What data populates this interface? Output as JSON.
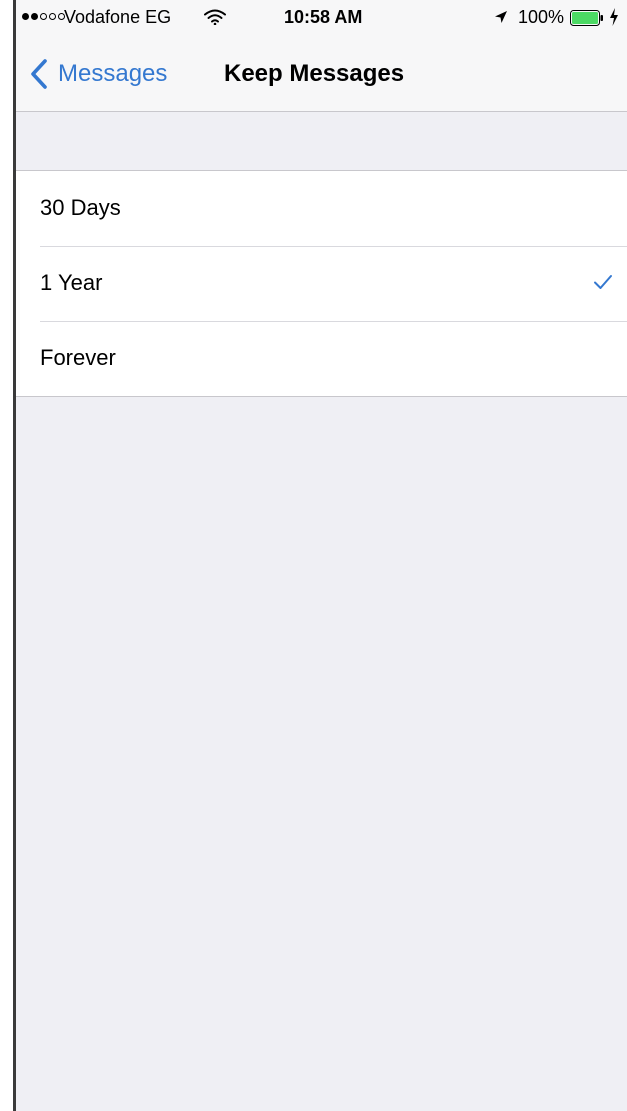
{
  "status_bar": {
    "carrier": "Vodafone EG",
    "signal_bars_filled": 2,
    "signal_bars_total": 5,
    "time": "10:58 AM",
    "battery_percent_label": "100%",
    "battery_level": 1.0,
    "icons": [
      "wifi-icon",
      "location-arrow-icon",
      "battery-icon",
      "charging-bolt-icon"
    ]
  },
  "nav": {
    "back_label": "Messages",
    "title": "Keep Messages",
    "back_icon": "chevron-left-icon"
  },
  "options": [
    {
      "label": "30 Days",
      "selected": false
    },
    {
      "label": "1 Year",
      "selected": true
    },
    {
      "label": "Forever",
      "selected": false
    }
  ],
  "colors": {
    "accent": "#3478d0",
    "background": "#efeff4",
    "row_background": "#ffffff",
    "separator": "#c8c7cc"
  }
}
